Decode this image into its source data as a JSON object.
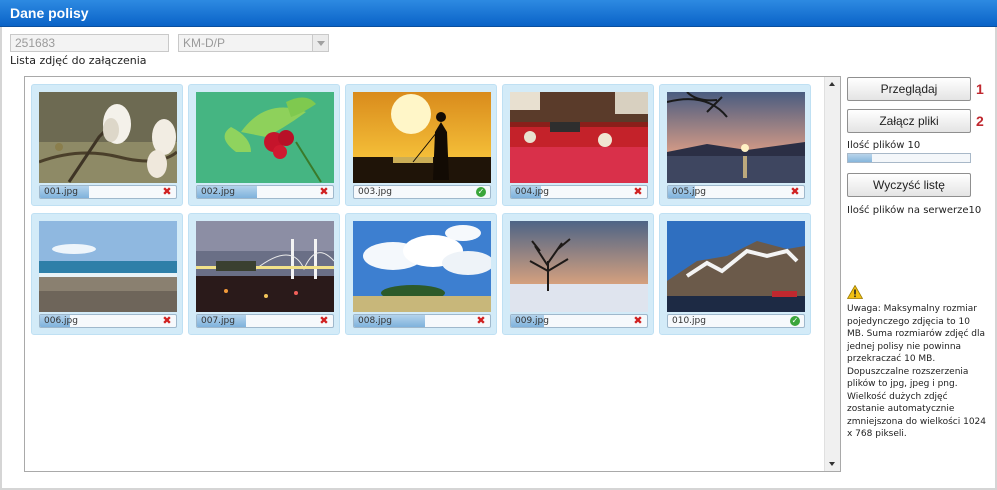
{
  "header": {
    "title": "Dane polisy"
  },
  "form": {
    "policy_number": "251683",
    "policy_type": "KM-D/P",
    "list_label": "Lista zdjęć do załączenia"
  },
  "files": [
    {
      "name": "001.jpg",
      "progress": 0.36,
      "status": "error",
      "thumbnail": "magnolia-flowers"
    },
    {
      "name": "002.jpg",
      "progress": 0.44,
      "status": "error",
      "thumbnail": "red-berries"
    },
    {
      "name": "003.jpg",
      "progress": 0.0,
      "status": "ok",
      "thumbnail": "sunset-fisherman"
    },
    {
      "name": "004.jpg",
      "progress": 0.22,
      "status": "error",
      "thumbnail": "fruit-market"
    },
    {
      "name": "005.jpg",
      "progress": 0.2,
      "status": "error",
      "thumbnail": "lake-sunset"
    },
    {
      "name": "006.jpg",
      "progress": 0.22,
      "status": "error",
      "thumbnail": "beach-shore"
    },
    {
      "name": "007.jpg",
      "progress": 0.36,
      "status": "error",
      "thumbnail": "night-bridge"
    },
    {
      "name": "008.jpg",
      "progress": 0.52,
      "status": "error",
      "thumbnail": "clouds-hill"
    },
    {
      "name": "009.jpg",
      "progress": 0.24,
      "status": "error",
      "thumbnail": "winter-tree-sunset"
    },
    {
      "name": "010.jpg",
      "progress": 0.0,
      "status": "ok",
      "thumbnail": "mountain-village"
    }
  ],
  "actions": {
    "browse_label": "Przeglądaj",
    "browse_step": "1",
    "attach_label": "Załącz pliki",
    "attach_step": "2",
    "file_count_label": "Ilość plików  10",
    "file_count_progress": 0.2,
    "clear_label": "Wyczyść listę",
    "server_count_label": "Ilość plików na serwerze10"
  },
  "notice": {
    "icon": "warning-icon",
    "text": "Uwaga: Maksymalny rozmiar pojedynczego zdjęcia to 10 MB. Suma rozmiarów zdjęć dla jednej polisy nie powinna przekraczać 10 MB. Dopuszczalne rozszerzenia plików to jpg, jpeg i png. Wielkość dużych zdjęć zostanie automatycznie zmniejszona do wielkości 1024 x 768 pikseli."
  },
  "colors": {
    "header": "#0a63c7",
    "tile": "#d3ebf8",
    "error": "#d02020",
    "ok": "#3aa53a",
    "step": "#c0282f"
  }
}
